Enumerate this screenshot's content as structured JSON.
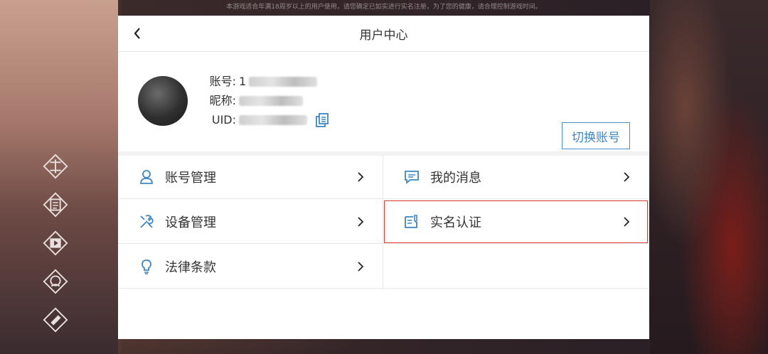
{
  "notice": "本游戏适合年满18周岁以上的用户使用，请您确定已如实进行实名注册，为了您的健康，请合理控制游戏时间。",
  "header": {
    "title": "用户中心"
  },
  "profile": {
    "account_label": "账号:",
    "account_value": "1",
    "nickname_label": "昵称:",
    "uid_label": "UID:",
    "switch_label": "切换账号"
  },
  "menu": {
    "items": [
      {
        "label": "账号管理",
        "icon": "user-icon"
      },
      {
        "label": "我的消息",
        "icon": "message-icon"
      },
      {
        "label": "设备管理",
        "icon": "tools-icon"
      },
      {
        "label": "实名认证",
        "icon": "id-card-icon"
      },
      {
        "label": "法律条款",
        "icon": "lightbulb-icon"
      }
    ]
  },
  "colors": {
    "accent": "#3f86c2",
    "highlight": "#d93a3a",
    "text": "#333333"
  }
}
